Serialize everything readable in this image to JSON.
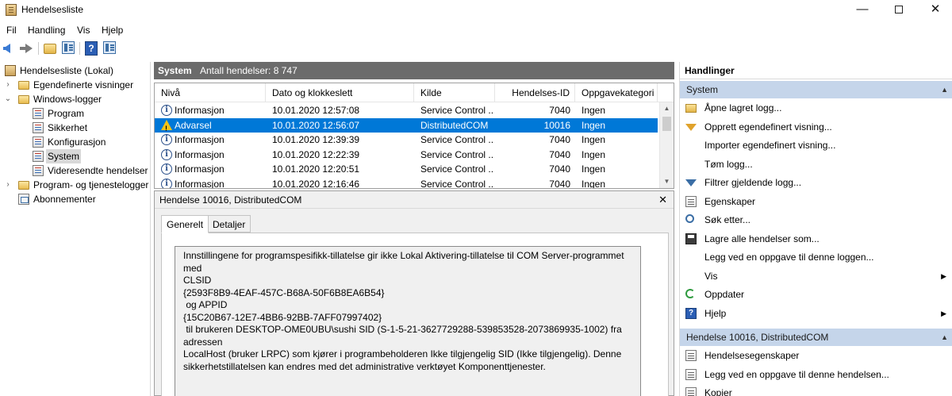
{
  "window": {
    "title": "Hendelsesliste",
    "minimize": "—",
    "close": "✕"
  },
  "menu": [
    "Fil",
    "Handling",
    "Vis",
    "Hjelp"
  ],
  "tree": {
    "items": [
      {
        "label": "Hendelsesliste (Lokal)",
        "expander": ""
      },
      {
        "label": "Egendefinerte visninger",
        "expander": "›"
      },
      {
        "label": "Windows-logger",
        "expander": "⌄"
      },
      {
        "label": "Program",
        "expander": ""
      },
      {
        "label": "Sikkerhet",
        "expander": ""
      },
      {
        "label": "Konfigurasjon",
        "expander": ""
      },
      {
        "label": "System",
        "expander": ""
      },
      {
        "label": "Videresendte hendelser",
        "expander": ""
      },
      {
        "label": "Program- og tjenestelogger",
        "expander": "›"
      },
      {
        "label": "Abonnementer",
        "expander": ""
      }
    ]
  },
  "center": {
    "title": "System",
    "count": "Antall hendelser: 8 747",
    "columns": [
      "Nivå",
      "Dato og klokkeslett",
      "Kilde",
      "Hendelses-ID",
      "Oppgavekategori"
    ],
    "rows": [
      {
        "level": "Informasjon",
        "date": "10.01.2020 12:57:08",
        "source": "Service Control ...",
        "id": "7040",
        "category": "Ingen"
      },
      {
        "level": "Advarsel",
        "date": "10.01.2020 12:56:07",
        "source": "DistributedCOM",
        "id": "10016",
        "category": "Ingen"
      },
      {
        "level": "Informasjon",
        "date": "10.01.2020 12:39:39",
        "source": "Service Control ...",
        "id": "7040",
        "category": "Ingen"
      },
      {
        "level": "Informasjon",
        "date": "10.01.2020 12:22:39",
        "source": "Service Control ...",
        "id": "7040",
        "category": "Ingen"
      },
      {
        "level": "Informasjon",
        "date": "10.01.2020 12:20:51",
        "source": "Service Control ...",
        "id": "7040",
        "category": "Ingen"
      },
      {
        "level": "Informasjon",
        "date": "10.01.2020 12:16:46",
        "source": "Service Control ...",
        "id": "7040",
        "category": "Ingen"
      }
    ],
    "scroll_up": "▲",
    "scroll_down": "▼"
  },
  "detail": {
    "title": "Hendelse 10016, DistributedCOM",
    "close": "✕",
    "tabs": [
      "Generelt",
      "Detaljer"
    ],
    "message": "Innstillingene for programspesifikk-tillatelse gir ikke Lokal Aktivering-tillatelse til COM Server-programmet med\nCLSID\n{2593F8B9-4EAF-457C-B68A-50F6B8EA6B54}\n og APPID\n{15C20B67-12E7-4BB6-92BB-7AFF07997402}\n til brukeren DESKTOP-OME0UBU\\sushi SID (S-1-5-21-3627729288-539853528-2073869935-1002) fra adressen\nLocalHost (bruker LRPC) som kjører i programbeholderen Ikke tilgjengelig SID (Ikke tilgjengelig). Denne\nsikkerhetstillatelsen kan endres med det administrative verktøyet Komponenttjenester."
  },
  "actions": {
    "header": "Handlinger",
    "section1": {
      "title": "System",
      "items": [
        {
          "label": "Åpne lagret logg...",
          "icon": "folder-open-icon"
        },
        {
          "label": "Opprett egendefinert visning...",
          "icon": "filter-create-icon"
        },
        {
          "label": "Importer egendefinert visning...",
          "icon": ""
        },
        {
          "label": "Tøm logg...",
          "icon": ""
        },
        {
          "label": "Filtrer gjeldende logg...",
          "icon": "filter-icon"
        },
        {
          "label": "Egenskaper",
          "icon": "properties-icon"
        },
        {
          "label": "Søk etter...",
          "icon": "search-icon"
        },
        {
          "label": "Lagre alle hendelser som...",
          "icon": "save-icon"
        },
        {
          "label": "Legg ved en oppgave til denne loggen...",
          "icon": ""
        },
        {
          "label": "Vis",
          "icon": "",
          "submenu": "▶"
        },
        {
          "label": "Oppdater",
          "icon": "refresh-icon"
        },
        {
          "label": "Hjelp",
          "icon": "help-icon",
          "submenu": "▶"
        }
      ]
    },
    "section2": {
      "title": "Hendelse 10016, DistributedCOM",
      "items": [
        {
          "label": "Hendelsesegenskaper",
          "icon": "properties-icon"
        },
        {
          "label": "Legg ved en oppgave til denne hendelsen...",
          "icon": "task-icon"
        },
        {
          "label": "Kopier",
          "icon": "copy-icon"
        }
      ]
    },
    "collapse": "▲"
  }
}
